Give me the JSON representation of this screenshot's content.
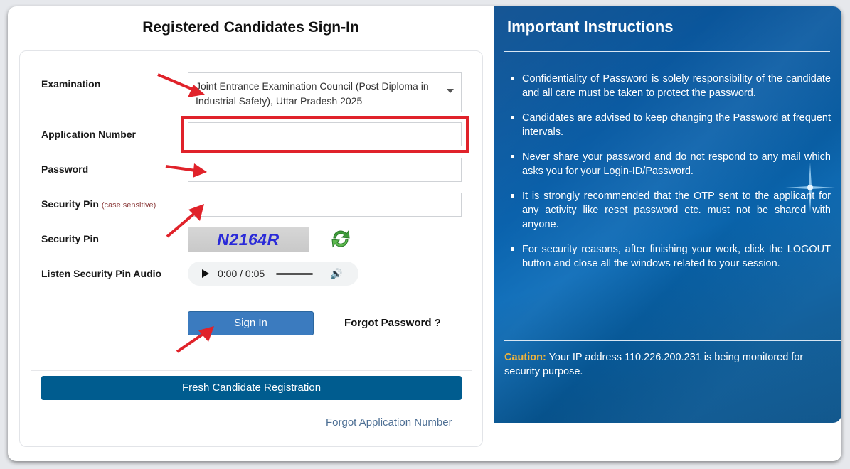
{
  "signin": {
    "title": "Registered Candidates Sign-In",
    "examination": {
      "label": "Examination",
      "selected_value": "Joint Entrance Examination Council (Post Diploma in Industrial Safety), Uttar Pradesh 2025"
    },
    "application_number": {
      "label": "Application Number",
      "value": ""
    },
    "password": {
      "label": "Password",
      "value": ""
    },
    "security_pin_input": {
      "label": "Security Pin",
      "hint": "(case sensitive)",
      "value": ""
    },
    "captcha": {
      "label": "Security Pin",
      "text": "N2164R"
    },
    "audio": {
      "label": "Listen Security Pin Audio",
      "time": "0:00 / 0:05"
    },
    "signin_button": "Sign In",
    "forgot_password": "Forgot Password ?",
    "fresh_registration": "Fresh Candidate Registration",
    "forgot_application_number": "Forgot Application Number"
  },
  "instructions": {
    "title": "Important Instructions",
    "items": [
      "Confidentiality of Password is solely responsibility of the candidate and all care must be taken to protect the password.",
      "Candidates are advised to keep changing the Password at frequent intervals.",
      "Never share your password and do not respond to any mail which asks you for your Login-ID/Password.",
      "It is strongly recommended that the OTP sent to the applicant for any activity like reset password etc. must not be shared with anyone.",
      "For security reasons, after finishing your work, click the LOGOUT button and close all the windows related to your session."
    ],
    "caution_label": "Caution:",
    "caution_text": " Your IP address 110.226.200.231 is being monitored for security purpose."
  },
  "colors": {
    "highlight": "#e0222a",
    "signin_button": "#3b7bbf",
    "fresh_button": "#005c8f",
    "caution": "#f0b43c",
    "panel": "#0b5fa8"
  }
}
